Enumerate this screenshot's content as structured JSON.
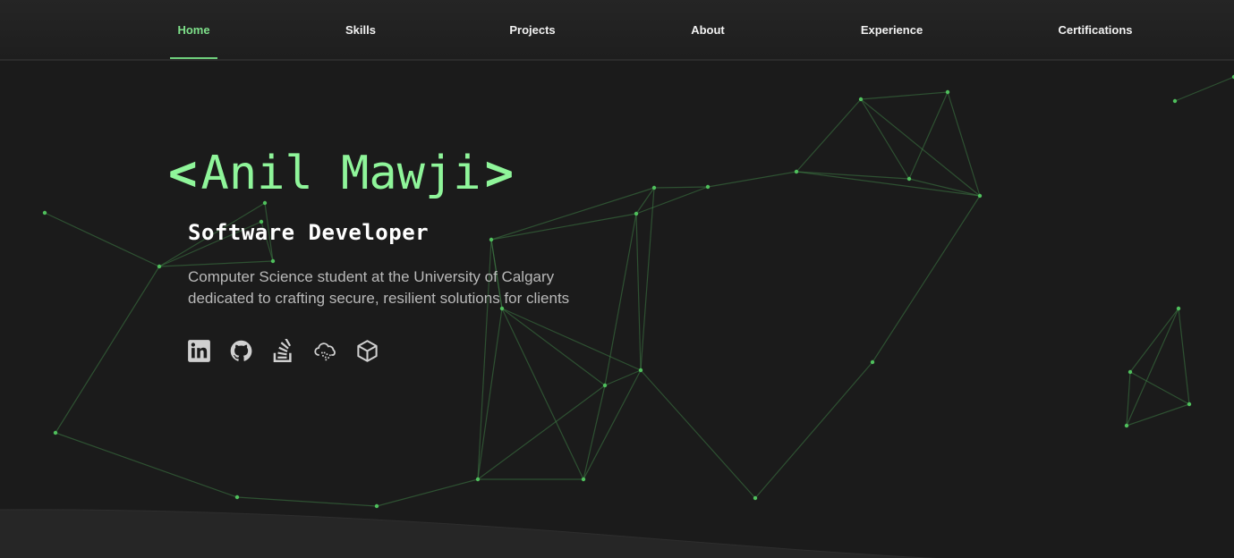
{
  "nav": {
    "items": [
      {
        "label": "Home",
        "active": true
      },
      {
        "label": "Skills",
        "active": false
      },
      {
        "label": "Projects",
        "active": false
      },
      {
        "label": "About",
        "active": false
      },
      {
        "label": "Experience",
        "active": false
      },
      {
        "label": "Certifications",
        "active": false
      }
    ]
  },
  "hero": {
    "bracket_open": "<",
    "name": "Anil Mawji",
    "bracket_close": ">",
    "role": "Software Developer",
    "description_line1": "Computer Science student at the University of Calgary",
    "description_line2": "dedicated to crafting secure, resilient solutions for clients",
    "socials": [
      {
        "icon": "linkedin-icon"
      },
      {
        "icon": "github-icon"
      },
      {
        "icon": "stackoverflow-icon"
      },
      {
        "icon": "cloud-certification-icon"
      },
      {
        "icon": "cube-icon"
      }
    ]
  },
  "colors": {
    "accent": "#8ff59a",
    "nav_active": "#7ee08a",
    "background": "#1b1b1b",
    "network": "#4caf50"
  }
}
